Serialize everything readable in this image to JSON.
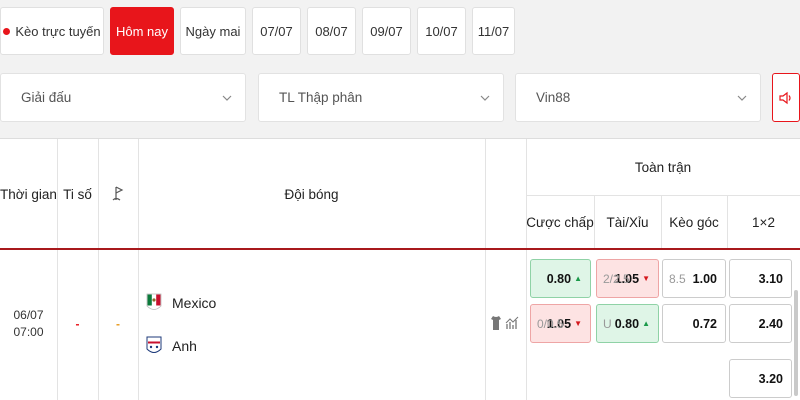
{
  "tabs": {
    "live": "Kèo trực tuyến",
    "today": "Hôm nay",
    "tomorrow": "Ngày mai",
    "d1": "07/07",
    "d2": "08/07",
    "d3": "09/07",
    "d4": "10/07",
    "d5": "11/07"
  },
  "filters": {
    "league": "Giải đấu",
    "odds_format": "TL Thập phân",
    "bookmaker": "Vin88"
  },
  "header": {
    "time": "Thời gian",
    "score": "Ti số",
    "teams": "Đội bóng",
    "full_match": "Toàn trận",
    "handicap": "Cược chấp",
    "over_under": "Tài/Xỉu",
    "corners": "Kèo góc",
    "one_x_two": "1×2"
  },
  "match": {
    "date": "06/07",
    "time": "07:00",
    "score": "-",
    "corner_score": "-",
    "home": "Mexico",
    "away": "Anh",
    "handicap": [
      {
        "line": "",
        "odd": "0.80",
        "trend": "up"
      },
      {
        "line": "0/0.5",
        "odd": "1.05",
        "trend": "down"
      }
    ],
    "over_under": [
      {
        "line": "2/2.5",
        "odd": "1.05",
        "trend": "down"
      },
      {
        "line": "U",
        "odd": "0.80",
        "trend": "up"
      }
    ],
    "corners": [
      {
        "line": "8.5",
        "odd": "1.00"
      },
      {
        "line": "",
        "odd": "0.72"
      }
    ],
    "one_x_two": [
      "3.10",
      "2.40",
      "3.20"
    ]
  },
  "colors": {
    "accent": "#e8151b",
    "up_bg": "#dff5e7",
    "down_bg": "#fde3e3",
    "header_rule": "#a8191c"
  },
  "icons": [
    "shirt-icon",
    "stats-icon",
    "corner-flag-icon",
    "chevron-down-icon",
    "speaker-icon"
  ]
}
